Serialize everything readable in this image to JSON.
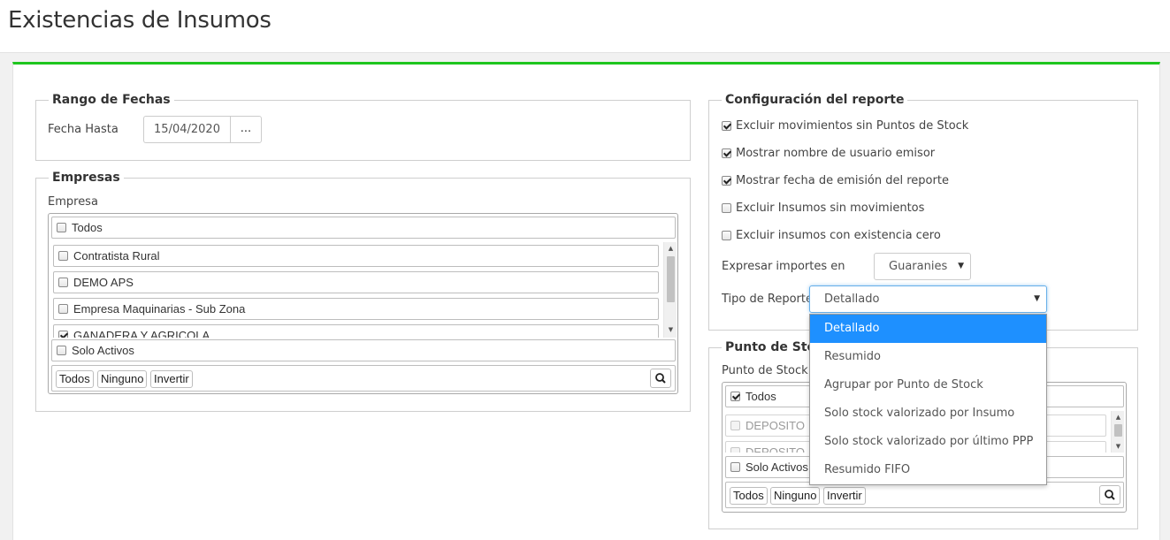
{
  "page": {
    "title": "Existencias de Insumos"
  },
  "rango_fechas": {
    "legend": "Rango de Fechas",
    "fecha_hasta_label": "Fecha Hasta",
    "fecha_hasta_value": "15/04/2020",
    "picker_label": "..."
  },
  "empresas": {
    "legend": "Empresas",
    "field_label": "Empresa",
    "todos_label": "Todos",
    "items": [
      {
        "label": "Contratista Rural",
        "checked": false
      },
      {
        "label": "DEMO APS",
        "checked": false
      },
      {
        "label": "Empresa Maquinarias - Sub Zona",
        "checked": false
      },
      {
        "label": "GANADERA Y AGRICOLA",
        "checked": true
      }
    ],
    "solo_activos_label": "Solo Activos",
    "buttons": {
      "todos": "Todos",
      "ninguno": "Ninguno",
      "invertir": "Invertir"
    }
  },
  "configuracion": {
    "legend": "Configuración del reporte",
    "options": [
      {
        "label": "Excluir movimientos sin Puntos de Stock",
        "checked": true
      },
      {
        "label": "Mostrar nombre de usuario emisor",
        "checked": true
      },
      {
        "label": "Mostrar fecha de emisión del reporte",
        "checked": true
      },
      {
        "label": "Excluir Insumos sin movimientos",
        "checked": false
      },
      {
        "label": "Excluir insumos con existencia cero",
        "checked": false
      }
    ],
    "importes_label": "Expresar importes en",
    "importes_value": "Guaranies",
    "tipo_reporte_label": "Tipo de Reporte",
    "tipo_reporte_value": "Detallado",
    "tipo_reporte_options": [
      {
        "label": "Detallado",
        "selected": true
      },
      {
        "label": "Resumido",
        "selected": false
      },
      {
        "label": "Agrupar por Punto de Stock",
        "selected": false
      },
      {
        "label": "Solo stock valorizado por Insumo",
        "selected": false
      },
      {
        "label": "Solo stock valorizado por último PPP",
        "selected": false
      },
      {
        "label": "Resumido FIFO",
        "selected": false
      }
    ]
  },
  "punto_stock": {
    "legend": "Punto de Stock",
    "field_label": "Punto de Stock",
    "todos_label": "Todos",
    "items": [
      {
        "label": "DEPOSITO"
      },
      {
        "label": "DEPOSITO"
      }
    ],
    "solo_activos_label": "Solo Activos",
    "buttons": {
      "todos": "Todos",
      "ninguno": "Ninguno",
      "invertir": "Invertir"
    }
  },
  "icons": {
    "search": "search-icon",
    "caret": "caret-down-icon"
  },
  "colors": {
    "accent": "#1ec51e",
    "selected": "#1e90ff"
  }
}
